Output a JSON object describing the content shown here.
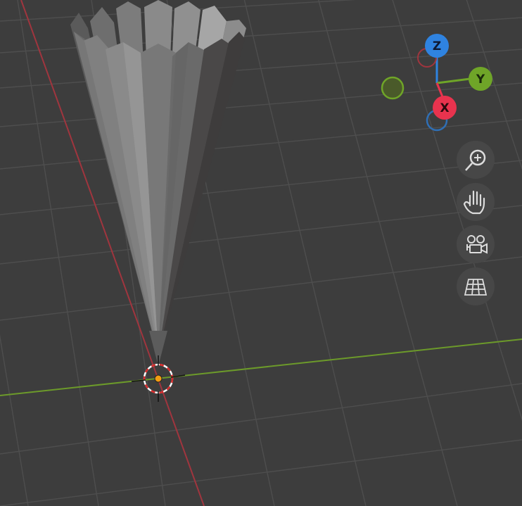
{
  "viewport": {
    "background_color": "#3d3d3d",
    "grid_line_color": "#505050",
    "x_axis_color": "#a0353e",
    "y_axis_color": "#6c9a2a"
  },
  "gizmo": {
    "z_label": "Z",
    "y_label": "Y",
    "x_label": "X",
    "z_color": "#2f83e0",
    "y_color": "#6fa528",
    "x_color": "#e8334e"
  },
  "nav_buttons": [
    {
      "name": "zoom",
      "icon": "zoom-in-icon"
    },
    {
      "name": "pan",
      "icon": "hand-icon"
    },
    {
      "name": "camera-view",
      "icon": "camera-icon"
    },
    {
      "name": "perspective-toggle",
      "icon": "grid-perspective-icon"
    }
  ],
  "cursor_3d": {
    "icon": "3d-cursor-icon"
  },
  "origin": {
    "color": "#f39c12"
  }
}
